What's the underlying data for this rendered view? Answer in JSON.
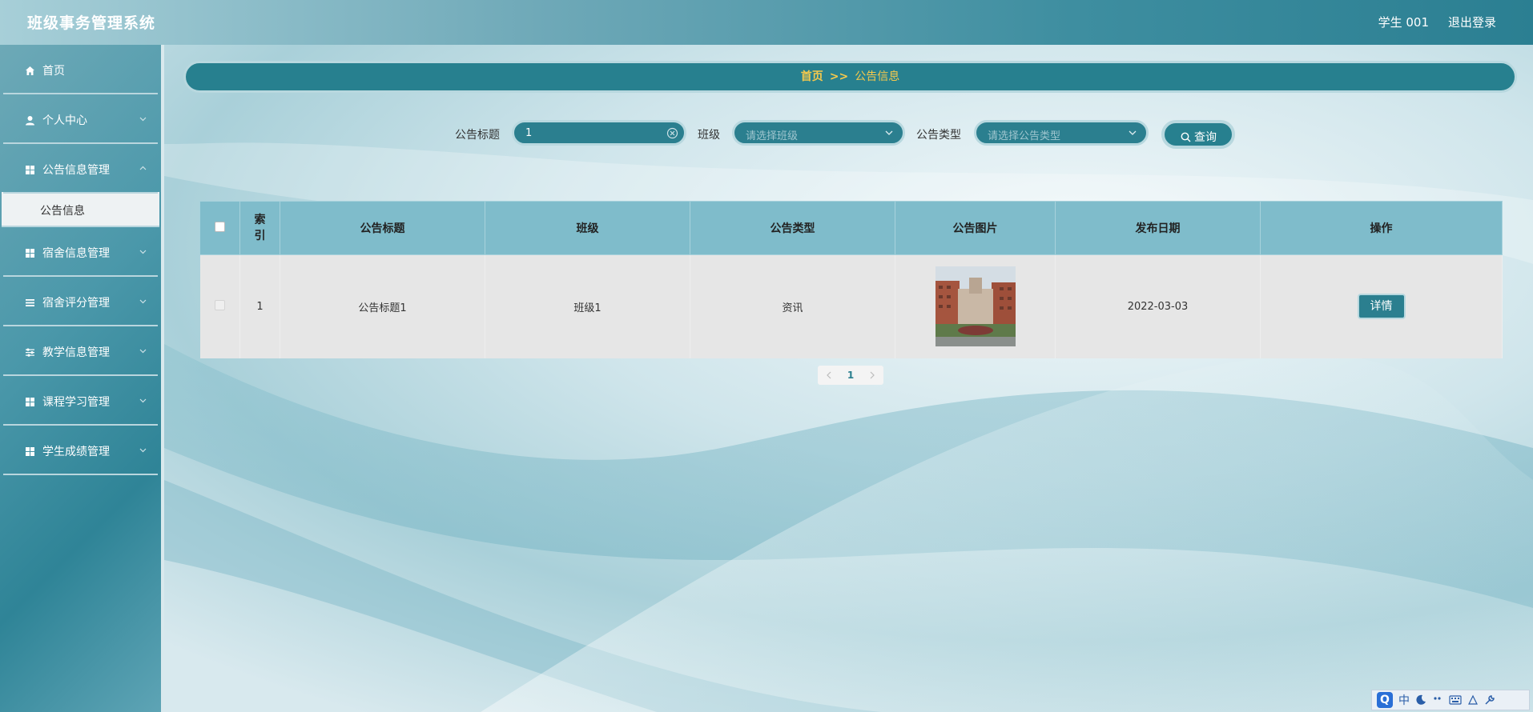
{
  "header": {
    "app_title": "班级事务管理系统",
    "user_label": "学生 001",
    "logout_label": "退出登录"
  },
  "sidebar": {
    "items": [
      {
        "label": "首页",
        "icon": "home-icon"
      },
      {
        "label": "个人中心",
        "icon": "user-icon"
      },
      {
        "label": "公告信息管理",
        "icon": "grid-icon"
      },
      {
        "label": "宿舍信息管理",
        "icon": "grid-icon"
      },
      {
        "label": "宿舍评分管理",
        "icon": "list-icon"
      },
      {
        "label": "教学信息管理",
        "icon": "sliders-icon"
      },
      {
        "label": "课程学习管理",
        "icon": "grid-icon"
      },
      {
        "label": "学生成绩管理",
        "icon": "grid-icon"
      }
    ],
    "active_submenu": "公告信息"
  },
  "breadcrumb": {
    "home": "首页",
    "separator": ">>",
    "current": "公告信息"
  },
  "search": {
    "title_label": "公告标题",
    "title_value": "1",
    "class_label": "班级",
    "class_placeholder": "请选择班级",
    "type_label": "公告类型",
    "type_placeholder": "请选择公告类型",
    "query_label": "查询"
  },
  "table": {
    "headers": [
      "索引",
      "公告标题",
      "班级",
      "公告类型",
      "公告图片",
      "发布日期",
      "操作"
    ],
    "rows": [
      {
        "index": "1",
        "title": "公告标题1",
        "class": "班级1",
        "type": "资讯",
        "image": "school-building-photo",
        "date": "2022-03-03",
        "action": "详情"
      }
    ]
  },
  "pagination": {
    "current_page": "1"
  },
  "ime_toolbar": {
    "logo": "Q",
    "mode": "中"
  },
  "colors": {
    "accent": "#27808f",
    "breadcrumb_text": "#f5c94c",
    "table_header": "#7fbccb",
    "row_bg": "#e6e6e6"
  }
}
